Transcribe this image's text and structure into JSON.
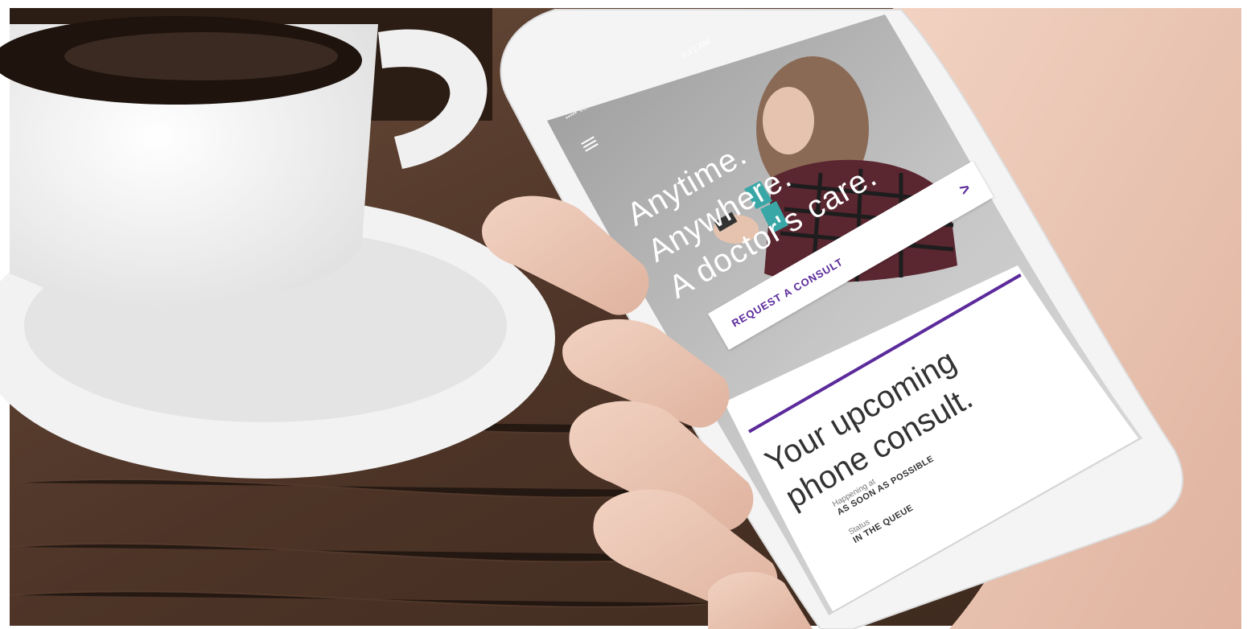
{
  "app": {
    "status_time": "9:41 AM",
    "carrier": "••••• Verizon",
    "menu_icon": "hamburger-icon"
  },
  "hero": {
    "lines": [
      "Anytime.",
      "Anywhere.",
      "A doctor's care."
    ]
  },
  "request_card": {
    "label": "REQUEST A CONSULT",
    "chevron": ">",
    "icon": "chevron-right-icon"
  },
  "consult": {
    "title_lines": [
      "Your upcoming",
      "phone consult."
    ],
    "happening_label": "Happening at",
    "happening_value": "AS SOON AS POSSIBLE",
    "status_label": "Status",
    "status_value": "IN THE QUEUE"
  },
  "colors": {
    "accent": "#5b2a9b",
    "text_dark": "#333333"
  }
}
